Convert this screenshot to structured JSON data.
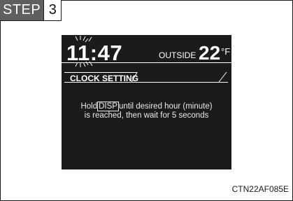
{
  "step": {
    "word": "STEP",
    "number": "3"
  },
  "display": {
    "time": "11:47",
    "outside_label": "OUTSIDE",
    "temperature": "22",
    "unit": "°F",
    "mode_title": "CLOCK SETTING",
    "message": {
      "before": "Hold",
      "button": "DISP",
      "after": "until desired hour (minute)",
      "line2": "is reached, then wait for 5 seconds"
    }
  },
  "figure_code": "CTN22AF085E",
  "colors": {
    "screen_background": "#1b1b1b",
    "screen_text": "#ffffff",
    "step_badge": "#5f5f5f"
  },
  "indicators": {
    "hour_blinking": true
  }
}
